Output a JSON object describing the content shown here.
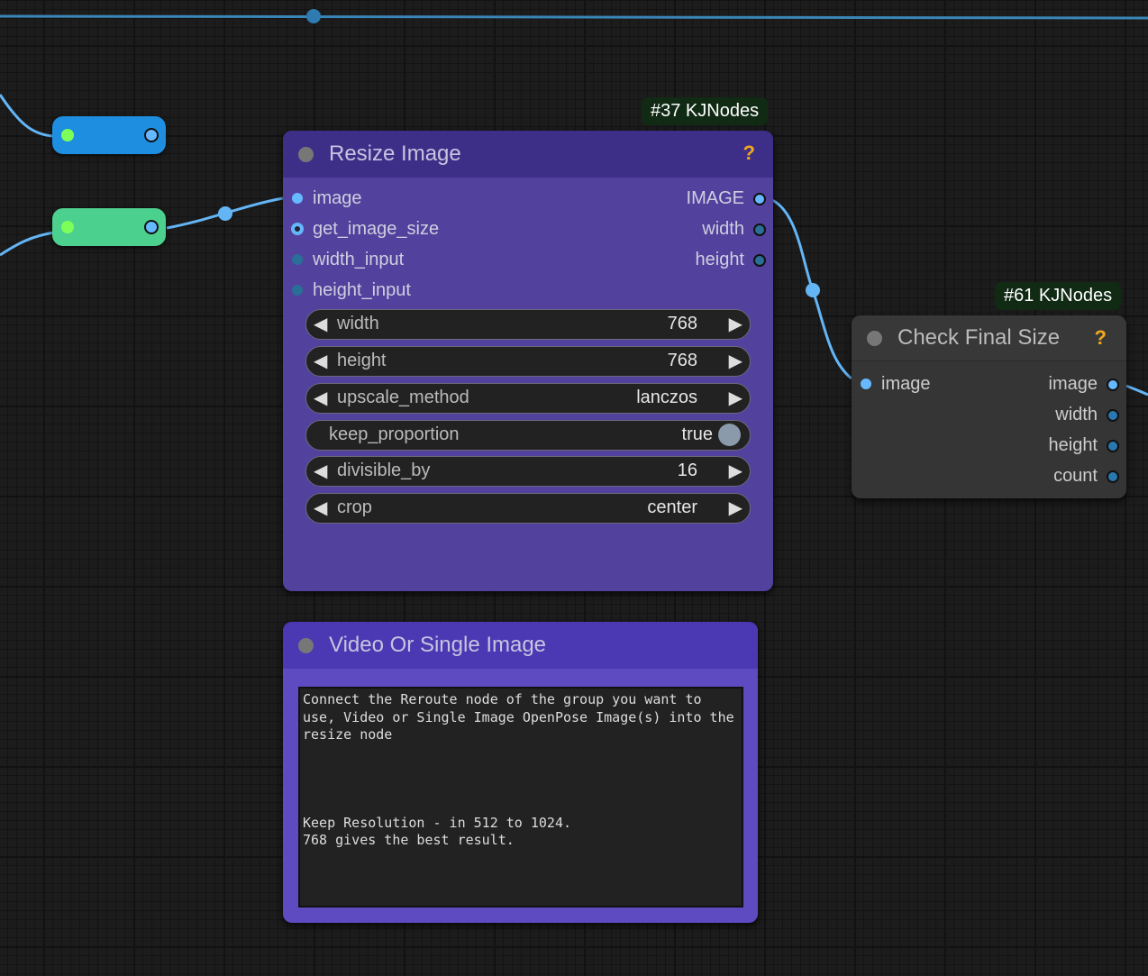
{
  "colors": {
    "link": "#64b5f6",
    "reroute_blue": "#1e8ee0",
    "reroute_green": "#4bd08e",
    "resize_title": "#3d2f88",
    "resize_body": "#52419d",
    "video_title": "#4a39b2",
    "video_body": "#5e4bc2",
    "check_bg": "#353535",
    "help": "#f2a81e"
  },
  "reroutes": [
    {
      "name": "reroute-blue",
      "color": "#1e8ee0"
    },
    {
      "name": "reroute-green",
      "color": "#4bd08e"
    }
  ],
  "resize_node": {
    "badge": "#37 KJNodes",
    "title": "Resize Image",
    "help": "?",
    "inputs": [
      "image",
      "get_image_size",
      "width_input",
      "height_input"
    ],
    "outputs": [
      "IMAGE",
      "width",
      "height"
    ],
    "widgets": [
      {
        "label": "width",
        "value": "768",
        "type": "number"
      },
      {
        "label": "height",
        "value": "768",
        "type": "number"
      },
      {
        "label": "upscale_method",
        "value": "lanczos",
        "type": "combo"
      },
      {
        "label": "keep_proportion",
        "value": "true",
        "type": "toggle"
      },
      {
        "label": "divisible_by",
        "value": "16",
        "type": "number"
      },
      {
        "label": "crop",
        "value": "center",
        "type": "combo"
      }
    ]
  },
  "check_node": {
    "badge": "#61 KJNodes",
    "title": "Check Final Size",
    "help": "?",
    "inputs": [
      "image"
    ],
    "outputs": [
      "image",
      "width",
      "height",
      "count"
    ]
  },
  "note_node": {
    "title": "Video Or Single Image",
    "text": "Connect the Reroute node of the group you want to use, Video or Single Image OpenPose Image(s) into the resize node\n\n\n\n\nKeep Resolution - in 512 to 1024.\n768 gives the best result."
  }
}
